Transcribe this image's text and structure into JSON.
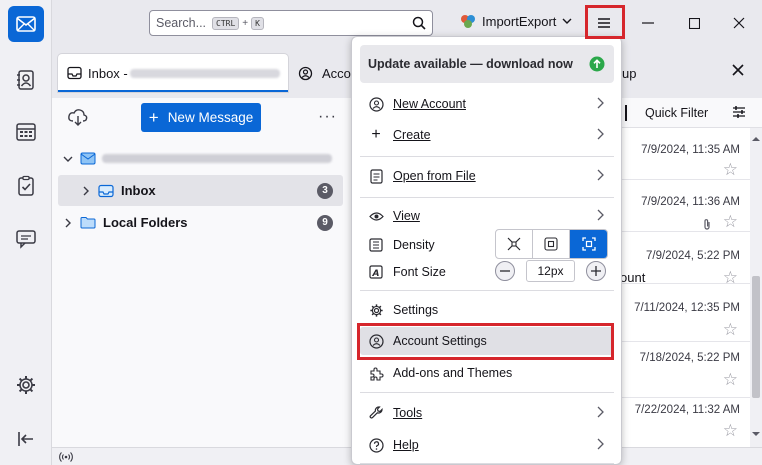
{
  "search": {
    "placeholder": "Search...",
    "key1": "CTRL",
    "plus": "+",
    "key2": "K"
  },
  "titlebar": {
    "addon_label": "ImportExport"
  },
  "tabs": [
    {
      "label": "Inbox - ",
      "obscured": "subtitle"
    },
    {
      "label": "Acco"
    },
    {
      "label": "up"
    }
  ],
  "toolbar": {
    "quick_filter": "Quick Filter"
  },
  "folder_pane": {
    "new_message": "New Message",
    "account_email": "redacted",
    "folders": [
      {
        "name": "Inbox",
        "count": "3"
      },
      {
        "name": "Local Folders",
        "count": "9"
      }
    ]
  },
  "messages": [
    {
      "date": "7/9/2024, 11:35 AM",
      "text": ""
    },
    {
      "date": "7/9/2024, 11:36 AM",
      "text": ""
    },
    {
      "date": "7/9/2024, 5:22 PM",
      "text": "ount"
    },
    {
      "date": "7/11/2024, 12:35 PM",
      "text": ""
    },
    {
      "date": "7/18/2024, 5:22 PM",
      "text": ""
    },
    {
      "date": "7/22/2024, 11:32 AM",
      "text": ""
    }
  ],
  "menu": {
    "update": "Update available — download now",
    "new_account": "New Account",
    "create": "Create",
    "open_from_file": "Open from File",
    "view": "View",
    "density": "Density",
    "font_size": "Font Size",
    "font_size_value": "12px",
    "settings": "Settings",
    "account_settings": "Account Settings",
    "addons": "Add-ons and Themes",
    "tools": "Tools",
    "help": "Help"
  },
  "colors": {
    "accent": "#0a67d6",
    "highlight_border": "#d6262c",
    "update_green": "#2ba84a"
  }
}
